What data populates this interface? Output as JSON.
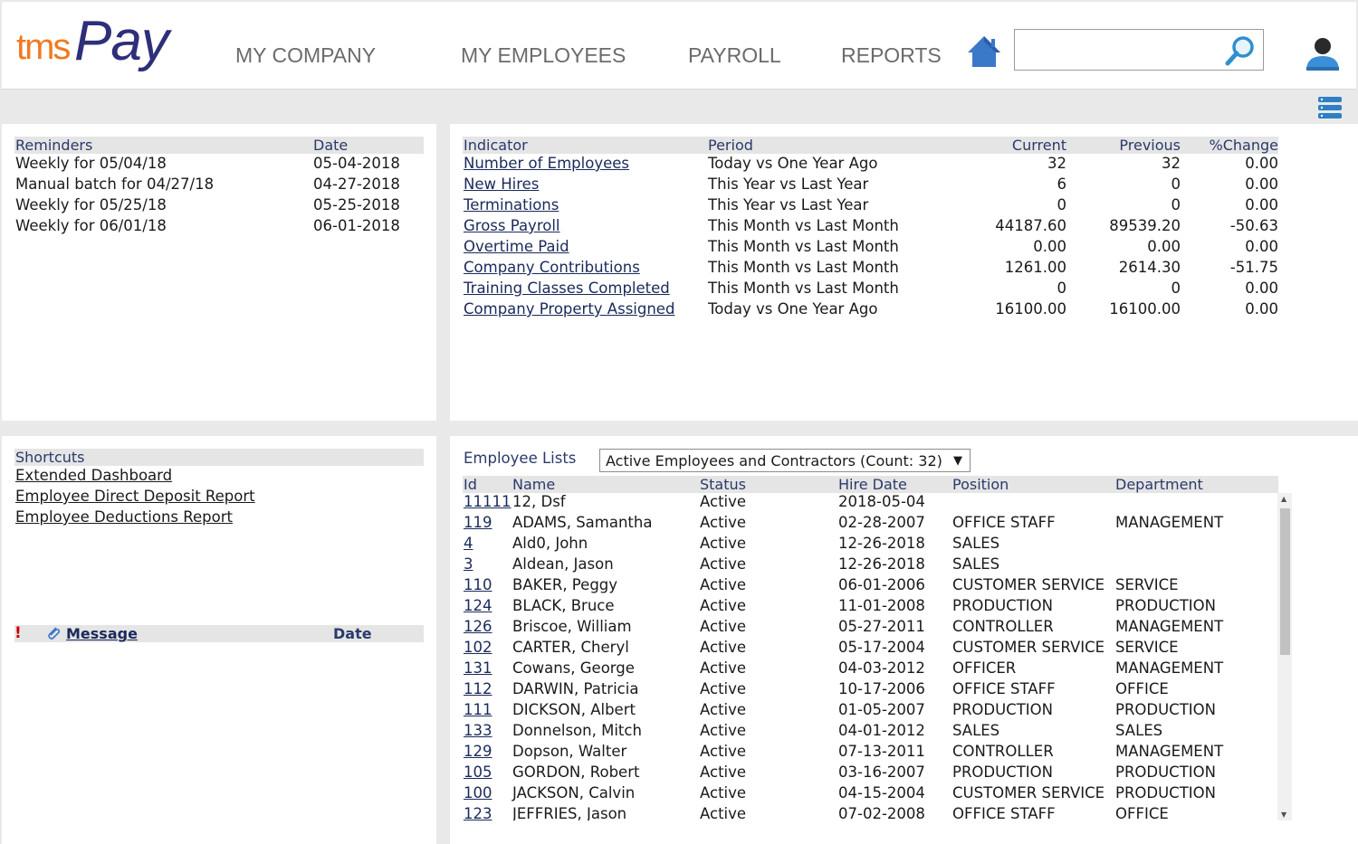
{
  "brand": {
    "logo_tms": "tms",
    "logo_pay": "Pay"
  },
  "nav": {
    "my_company": "MY COMPANY",
    "my_employees": "MY EMPLOYEES",
    "payroll": "PAYROLL",
    "reports": "REPORTS"
  },
  "search": {
    "value": "",
    "placeholder": ""
  },
  "icons": {
    "home": "home-icon",
    "search": "search-icon",
    "user": "user-icon",
    "stack": "database-stack-icon",
    "paperclip": "paperclip-icon",
    "exclamation": "exclamation-icon"
  },
  "colors": {
    "brand_orange": "#ef7a22",
    "brand_navy": "#2e2f7a",
    "icon_blue": "#3a78c8",
    "alert_red": "#cc0000"
  },
  "reminders": {
    "headers": {
      "reminders": "Reminders",
      "date": "Date"
    },
    "rows": [
      {
        "name": "Weekly for 05/04/18",
        "date": "05-04-2018"
      },
      {
        "name": "Manual batch for 04/27/18",
        "date": "04-27-2018"
      },
      {
        "name": "Weekly for 05/25/18",
        "date": "05-25-2018"
      },
      {
        "name": "Weekly for 06/01/18",
        "date": "06-01-2018"
      }
    ]
  },
  "indicators": {
    "headers": {
      "indicator": "Indicator",
      "period": "Period",
      "current": "Current",
      "previous": "Previous",
      "change": "%Change"
    },
    "rows": [
      {
        "indicator": "Number of Employees",
        "period": "Today vs One Year Ago",
        "current": "32",
        "previous": "32",
        "change": "0.00"
      },
      {
        "indicator": "New Hires",
        "period": "This Year vs Last Year",
        "current": "6",
        "previous": "0",
        "change": "0.00"
      },
      {
        "indicator": "Terminations",
        "period": "This Year vs Last Year",
        "current": "0",
        "previous": "0",
        "change": "0.00"
      },
      {
        "indicator": "Gross Payroll",
        "period": "This Month vs Last Month",
        "current": "44187.60",
        "previous": "89539.20",
        "change": "-50.63"
      },
      {
        "indicator": "Overtime Paid",
        "period": "This Month vs Last Month",
        "current": "0.00",
        "previous": "0.00",
        "change": "0.00"
      },
      {
        "indicator": "Company Contributions",
        "period": "This Month vs Last Month",
        "current": "1261.00",
        "previous": "2614.30",
        "change": "-51.75"
      },
      {
        "indicator": "Training Classes Completed",
        "period": "This Month vs Last Month",
        "current": "0",
        "previous": "0",
        "change": "0.00"
      },
      {
        "indicator": "Company Property Assigned",
        "period": "Today vs One Year Ago",
        "current": "16100.00",
        "previous": "16100.00",
        "change": "0.00"
      }
    ]
  },
  "shortcuts": {
    "header": "Shortcuts",
    "items": [
      "Extended Dashboard",
      "Employee Direct Deposit Report",
      "Employee Deductions Report"
    ]
  },
  "messages": {
    "flag": "!",
    "message_header": "Message",
    "date_header": "Date"
  },
  "employees": {
    "label": "Employee Lists",
    "selected_list": "Active Employees and Contractors (Count: 32)",
    "arrow": "▼",
    "headers": {
      "id": "Id",
      "name": "Name",
      "status": "Status",
      "hire_date": "Hire Date",
      "position": "Position",
      "department": "Department"
    },
    "rows": [
      {
        "id": "11111",
        "name": "12, Dsf",
        "status": "Active",
        "hire_date": "2018-05-04",
        "position": "",
        "department": ""
      },
      {
        "id": "119",
        "name": "ADAMS, Samantha",
        "status": "Active",
        "hire_date": "02-28-2007",
        "position": "OFFICE STAFF",
        "department": "MANAGEMENT"
      },
      {
        "id": "4",
        "name": "Ald0, John",
        "status": "Active",
        "hire_date": "12-26-2018",
        "position": "SALES",
        "department": ""
      },
      {
        "id": "3",
        "name": "Aldean, Jason",
        "status": "Active",
        "hire_date": "12-26-2018",
        "position": "SALES",
        "department": ""
      },
      {
        "id": "110",
        "name": "BAKER, Peggy",
        "status": "Active",
        "hire_date": "06-01-2006",
        "position": "CUSTOMER SERVICE",
        "department": "SERVICE"
      },
      {
        "id": "124",
        "name": "BLACK, Bruce",
        "status": "Active",
        "hire_date": "11-01-2008",
        "position": "PRODUCTION",
        "department": "PRODUCTION"
      },
      {
        "id": "126",
        "name": "Briscoe, William",
        "status": "Active",
        "hire_date": "05-27-2011",
        "position": "CONTROLLER",
        "department": "MANAGEMENT"
      },
      {
        "id": "102",
        "name": "CARTER, Cheryl",
        "status": "Active",
        "hire_date": "05-17-2004",
        "position": "CUSTOMER SERVICE",
        "department": "SERVICE"
      },
      {
        "id": "131",
        "name": "Cowans, George",
        "status": "Active",
        "hire_date": "04-03-2012",
        "position": "OFFICER",
        "department": "MANAGEMENT"
      },
      {
        "id": "112",
        "name": "DARWIN, Patricia",
        "status": "Active",
        "hire_date": "10-17-2006",
        "position": "OFFICE STAFF",
        "department": "OFFICE"
      },
      {
        "id": "111",
        "name": "DICKSON, Albert",
        "status": "Active",
        "hire_date": "01-05-2007",
        "position": "PRODUCTION",
        "department": "PRODUCTION"
      },
      {
        "id": "133",
        "name": "Donnelson, Mitch",
        "status": "Active",
        "hire_date": "04-01-2012",
        "position": "SALES",
        "department": "SALES"
      },
      {
        "id": "129",
        "name": "Dopson, Walter",
        "status": "Active",
        "hire_date": "07-13-2011",
        "position": "CONTROLLER",
        "department": "MANAGEMENT"
      },
      {
        "id": "105",
        "name": "GORDON, Robert",
        "status": "Active",
        "hire_date": "03-16-2007",
        "position": "PRODUCTION",
        "department": "PRODUCTION"
      },
      {
        "id": "100",
        "name": "JACKSON, Calvin",
        "status": "Active",
        "hire_date": "04-15-2004",
        "position": "CUSTOMER SERVICE",
        "department": "PRODUCTION"
      },
      {
        "id": "123",
        "name": "JEFFRIES, Jason",
        "status": "Active",
        "hire_date": "07-02-2008",
        "position": "OFFICE STAFF",
        "department": "OFFICE"
      }
    ]
  }
}
